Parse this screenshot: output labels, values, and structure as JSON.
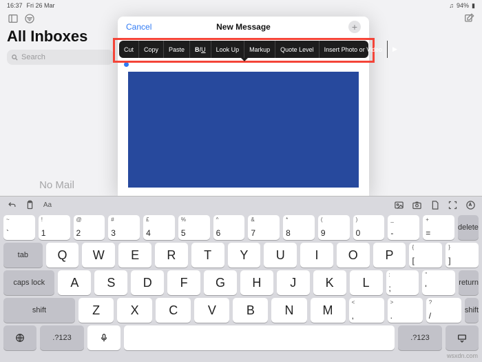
{
  "status": {
    "time": "16:37",
    "date": "Fri 26 Mar",
    "battery": "94%",
    "battery_icon": "▮"
  },
  "mail": {
    "title": "All Inboxes",
    "search_placeholder": "Search",
    "empty": "No Mail"
  },
  "compose": {
    "cancel": "Cancel",
    "title": "New Message"
  },
  "context_menu": [
    "Cut",
    "Copy",
    "Paste",
    "BIU",
    "Look Up",
    "Markup",
    "Quote Level",
    "Insert Photo or Video"
  ],
  "keyboard": {
    "numrow": [
      {
        "sup": "~",
        "main": "`"
      },
      {
        "sup": "!",
        "main": "1"
      },
      {
        "sup": "@",
        "main": "2"
      },
      {
        "sup": "#",
        "main": "3"
      },
      {
        "sup": "£",
        "main": "4"
      },
      {
        "sup": "%",
        "main": "5"
      },
      {
        "sup": "^",
        "main": "6"
      },
      {
        "sup": "&",
        "main": "7"
      },
      {
        "sup": "*",
        "main": "8"
      },
      {
        "sup": "(",
        "main": "9"
      },
      {
        "sup": ")",
        "main": "0"
      },
      {
        "sup": "_",
        "main": "-"
      },
      {
        "sup": "+",
        "main": "="
      }
    ],
    "del": "delete",
    "tab": "tab",
    "row2": [
      "Q",
      "W",
      "E",
      "R",
      "T",
      "Y",
      "U",
      "I",
      "O",
      "P"
    ],
    "row2end": [
      {
        "sup": "{",
        "main": "["
      },
      {
        "sup": "}",
        "main": "]"
      }
    ],
    "caps": "caps lock",
    "row3": [
      "A",
      "S",
      "D",
      "F",
      "G",
      "H",
      "J",
      "K",
      "L"
    ],
    "row3end": [
      {
        "sup": ":",
        "main": ";"
      },
      {
        "sup": "\"",
        "main": "'"
      }
    ],
    "return": "return",
    "shift": "shift",
    "row4": [
      "Z",
      "X",
      "C",
      "V",
      "B",
      "N",
      "M"
    ],
    "row4end": [
      {
        "sup": "<",
        "main": ","
      },
      {
        "sup": ">",
        "main": "."
      },
      {
        "sup": "?",
        "main": "/"
      }
    ],
    "numkey": ".?123",
    "aa": "Aa"
  },
  "watermark": "wsxdn.com"
}
